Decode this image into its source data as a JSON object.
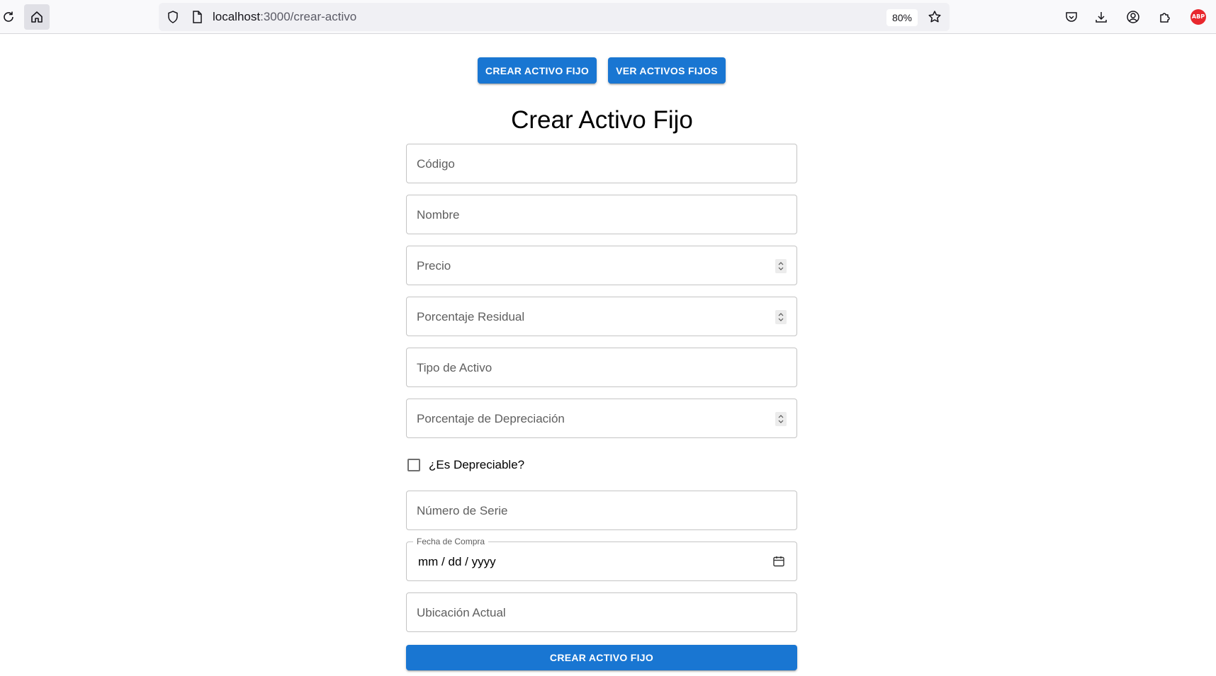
{
  "browser": {
    "url_host": "localhost",
    "url_path": ":3000/crear-activo",
    "zoom": "80%",
    "extension_badge": "ABP"
  },
  "nav": {
    "create_label": "CREAR ACTIVO FIJO",
    "view_label": "VER ACTIVOS FIJOS"
  },
  "form": {
    "title": "Crear Activo Fijo",
    "fields": {
      "codigo": "Código",
      "nombre": "Nombre",
      "precio": "Precio",
      "porcentaje_residual": "Porcentaje Residual",
      "tipo_activo": "Tipo de Activo",
      "porcentaje_depreciacion": "Porcentaje de Depreciación",
      "numero_serie": "Número de Serie",
      "fecha_compra_label": "Fecha de Compra",
      "fecha_compra_value": "mm / dd / yyyy",
      "ubicacion_actual": "Ubicación Actual"
    },
    "checkbox_label": "¿Es Depreciable?",
    "checkbox_checked": false,
    "submit_label": "CREAR ACTIVO FIJO"
  },
  "colors": {
    "primary": "#1976d2",
    "border": "#c4c4c4"
  }
}
